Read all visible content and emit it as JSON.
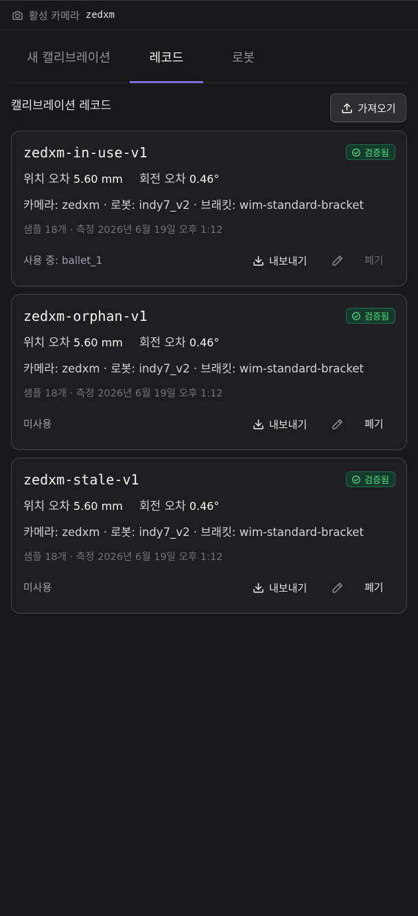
{
  "header": {
    "icon": "camera-icon",
    "label": "활성 카메라",
    "camera": "zedxm"
  },
  "tabs": [
    {
      "label": "새 캘리브레이션",
      "active": false
    },
    {
      "label": "레코드",
      "active": true
    },
    {
      "label": "로봇",
      "active": false
    }
  ],
  "section": {
    "title": "캘리브레이션 레코드",
    "import_label": "가져오기"
  },
  "colors": {
    "accent": "#7a6fd8",
    "badge_green": "#4ade80",
    "background": "#18181b",
    "card": "#1e1e22"
  },
  "records": [
    {
      "name": "zedxm-in-use-v1",
      "badge": "검증됨",
      "position_label": "위치 오차",
      "position_value": "5.60 mm",
      "rotation_label": "회전 오차",
      "rotation_value": "0.46°",
      "meta": "카메라: zedxm · 로봇: indy7_v2 · 브래킷: wim-standard-bracket",
      "sub": "샘플 18개 · 측정 2026년 6월 19일 오후 1:12",
      "usage": "사용 중: ballet_1",
      "export_label": "내보내기",
      "retire_label": "폐기",
      "retire_enabled": false
    },
    {
      "name": "zedxm-orphan-v1",
      "badge": "검증됨",
      "position_label": "위치 오차",
      "position_value": "5.60 mm",
      "rotation_label": "회전 오차",
      "rotation_value": "0.46°",
      "meta": "카메라: zedxm · 로봇: indy7_v2 · 브래킷: wim-standard-bracket",
      "sub": "샘플 18개 · 측정 2026년 6월 19일 오후 1:12",
      "usage": "미사용",
      "export_label": "내보내기",
      "retire_label": "폐기",
      "retire_enabled": true
    },
    {
      "name": "zedxm-stale-v1",
      "badge": "검증됨",
      "position_label": "위치 오차",
      "position_value": "5.60 mm",
      "rotation_label": "회전 오차",
      "rotation_value": "0.46°",
      "meta": "카메라: zedxm · 로봇: indy7_v2 · 브래킷: wim-standard-bracket",
      "sub": "샘플 18개 · 측정 2026년 6월 19일 오후 1:12",
      "usage": "미사용",
      "export_label": "내보내기",
      "retire_label": "폐기",
      "retire_enabled": true
    }
  ]
}
